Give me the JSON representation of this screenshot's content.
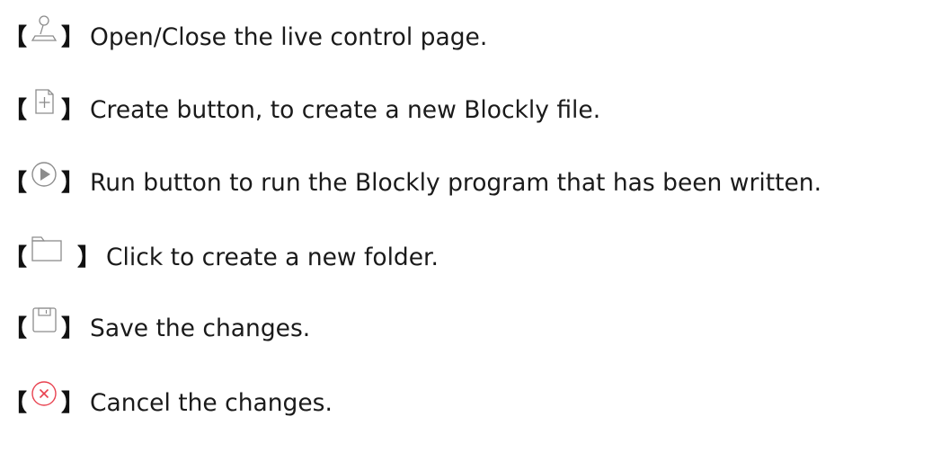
{
  "rows": [
    {
      "icon": "joystick-icon",
      "text": "Open/Close the live control page."
    },
    {
      "icon": "new-file-icon",
      "text": "Create button, to create a new Blockly file."
    },
    {
      "icon": "play-icon",
      "text": "Run button to run the Blockly program that has been written."
    },
    {
      "icon": "folder-icon",
      "text": "Click to create a new folder."
    },
    {
      "icon": "save-icon",
      "text": "Save the changes."
    },
    {
      "icon": "cancel-icon",
      "text": "Cancel the changes."
    }
  ],
  "brackets": {
    "open": "【",
    "close": "】"
  },
  "colors": {
    "icon_gray": "#8c8c8c",
    "cancel_red": "#e8414f",
    "text": "#1a1a1a"
  }
}
